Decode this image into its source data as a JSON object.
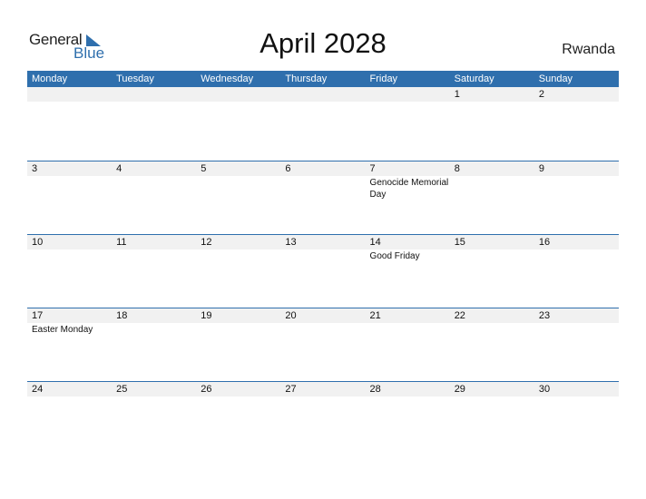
{
  "logo": {
    "part1": "General",
    "part2": "Blue"
  },
  "title": "April 2028",
  "country": "Rwanda",
  "colors": {
    "accent": "#2f6fad",
    "strip": "#f1f1f1"
  },
  "weekdays": [
    "Monday",
    "Tuesday",
    "Wednesday",
    "Thursday",
    "Friday",
    "Saturday",
    "Sunday"
  ],
  "weeks": [
    [
      {
        "day": ""
      },
      {
        "day": ""
      },
      {
        "day": ""
      },
      {
        "day": ""
      },
      {
        "day": ""
      },
      {
        "day": "1"
      },
      {
        "day": "2"
      }
    ],
    [
      {
        "day": "3"
      },
      {
        "day": "4"
      },
      {
        "day": "5"
      },
      {
        "day": "6"
      },
      {
        "day": "7",
        "holiday": "Genocide Memorial Day"
      },
      {
        "day": "8"
      },
      {
        "day": "9"
      }
    ],
    [
      {
        "day": "10"
      },
      {
        "day": "11"
      },
      {
        "day": "12"
      },
      {
        "day": "13"
      },
      {
        "day": "14",
        "holiday": "Good Friday"
      },
      {
        "day": "15"
      },
      {
        "day": "16"
      }
    ],
    [
      {
        "day": "17",
        "holiday": "Easter Monday"
      },
      {
        "day": "18"
      },
      {
        "day": "19"
      },
      {
        "day": "20"
      },
      {
        "day": "21"
      },
      {
        "day": "22"
      },
      {
        "day": "23"
      }
    ],
    [
      {
        "day": "24"
      },
      {
        "day": "25"
      },
      {
        "day": "26"
      },
      {
        "day": "27"
      },
      {
        "day": "28"
      },
      {
        "day": "29"
      },
      {
        "day": "30"
      }
    ]
  ]
}
